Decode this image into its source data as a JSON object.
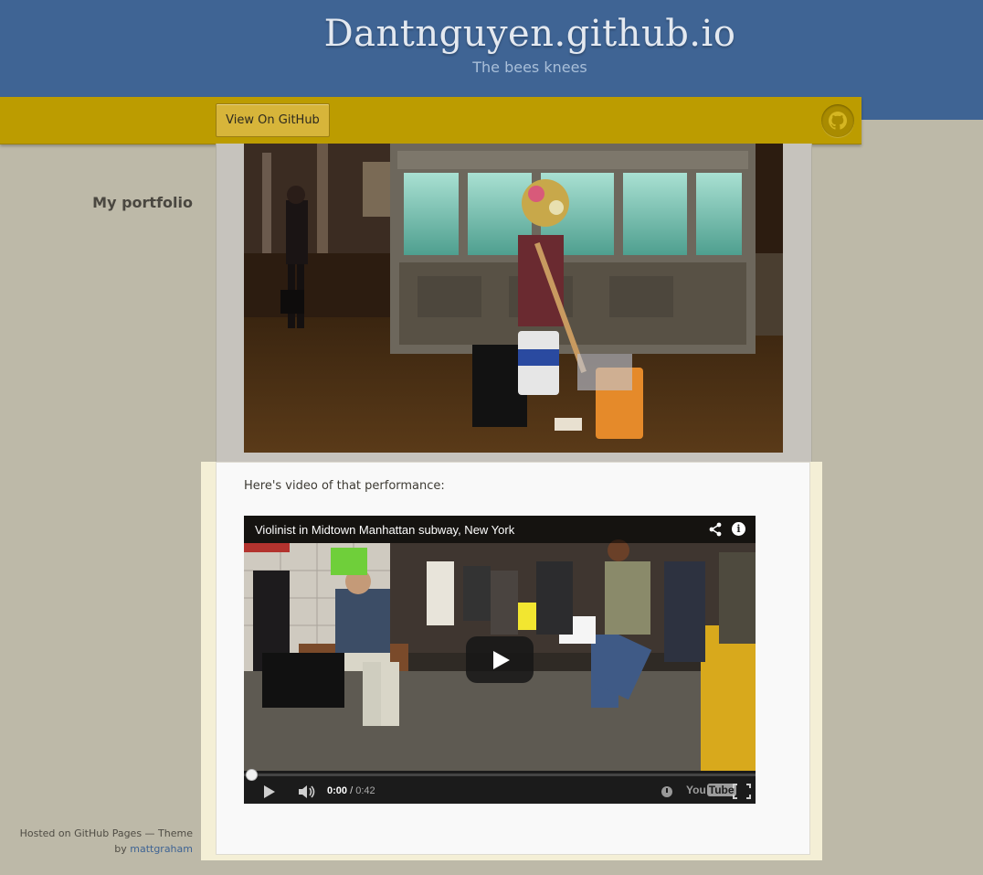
{
  "header": {
    "site_title": "Dantnguyen.github.io",
    "tagline": "The bees knees",
    "background_color": "#3f6494"
  },
  "ribbon": {
    "view_on_github_label": "View On GitHub",
    "ribbon_color": "#bc9c00",
    "icon": "github-octocat-icon"
  },
  "sidebar": {
    "title": "My portfolio"
  },
  "main": {
    "photo": {
      "alt": "Street performer in Midtown Manhattan at night"
    },
    "caption": "Here's video of that performance:",
    "video": {
      "title": "Violinist in Midtown Manhattan subway, New York",
      "current_time": "0:00",
      "separator": " / ",
      "duration": "0:42",
      "progress_fraction": 0.0,
      "logo_you": "You",
      "logo_tube": "Tube",
      "icons": {
        "share": "share-icon",
        "info": "info-icon",
        "play": "play-icon",
        "volume": "volume-icon",
        "watch_later": "clock-icon",
        "fullscreen": "fullscreen-icon"
      }
    }
  },
  "footer": {
    "text": "Hosted on GitHub Pages — Theme",
    "by": "by",
    "author_link": "mattgraham",
    "link_color": "#3f6494"
  }
}
